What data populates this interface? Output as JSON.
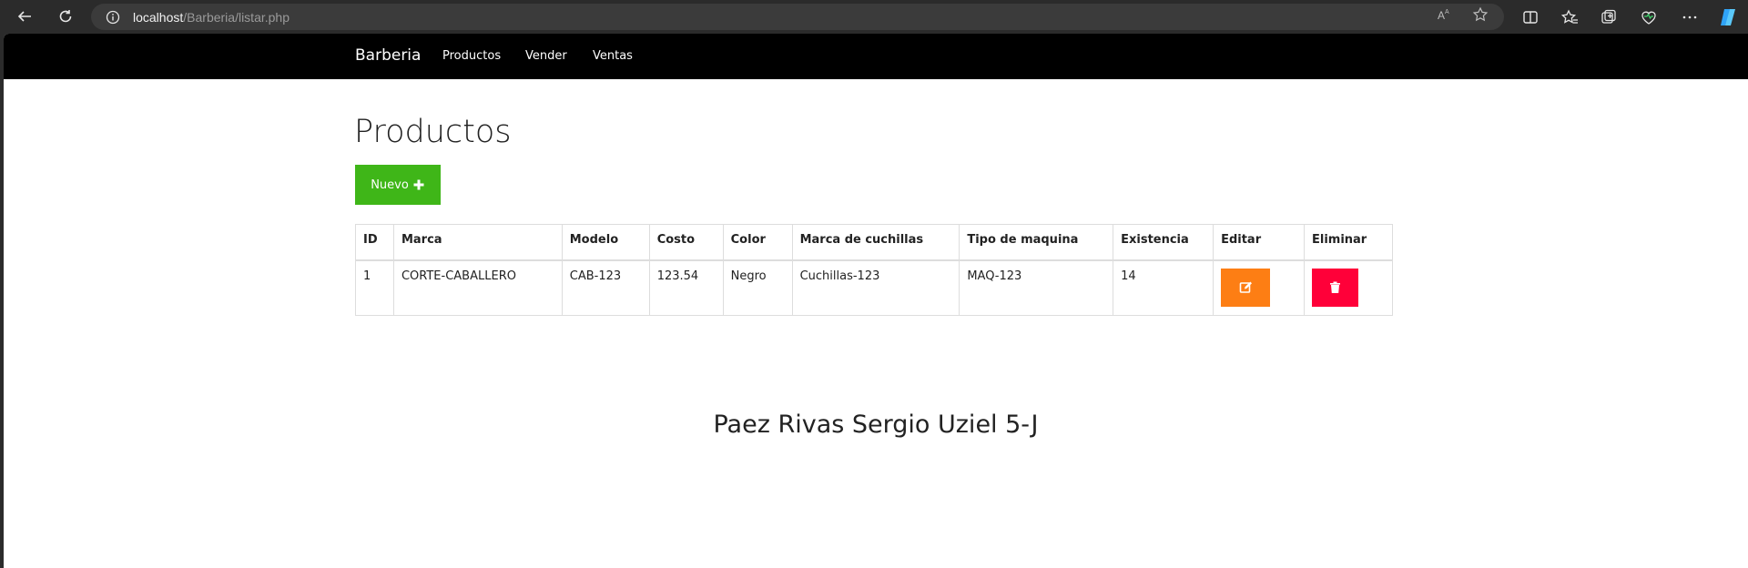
{
  "browser": {
    "url_host": "localhost",
    "url_path": "/Barberia/listar.php"
  },
  "navbar": {
    "brand": "Barberia",
    "links": [
      "Productos",
      "Vender",
      "Ventas"
    ]
  },
  "page": {
    "title": "Productos",
    "new_button": "Nuevo"
  },
  "table": {
    "headers": [
      "ID",
      "Marca",
      "Modelo",
      "Costo",
      "Color",
      "Marca de cuchillas",
      "Tipo de maquina",
      "Existencia",
      "Editar",
      "Eliminar"
    ],
    "rows": [
      [
        "1",
        "CORTE-CABALLERO",
        "CAB-123",
        "123.54",
        "Negro",
        "Cuchillas-123",
        "MAQ-123",
        "14"
      ]
    ]
  },
  "footer": {
    "name": "Paez Rivas Sergio Uziel 5-J"
  },
  "colors": {
    "nuevo": "#3fb618",
    "edit": "#fd7e14",
    "delete": "#ff0039",
    "navbar": "#000000"
  }
}
